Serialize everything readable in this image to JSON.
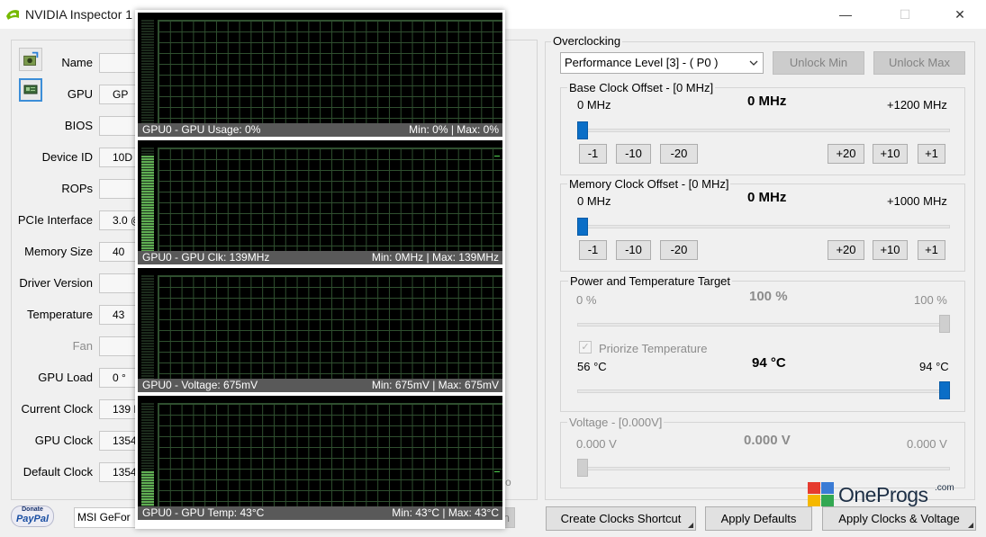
{
  "window": {
    "title": "NVIDIA Inspector 1",
    "minimize_icon": "—",
    "maximize_icon": "☐",
    "close_icon": "✕"
  },
  "left_panel": {
    "fields": [
      {
        "label": "Name",
        "value": "",
        "disabled": false
      },
      {
        "label": "GPU",
        "value": "GP",
        "disabled": false
      },
      {
        "label": "BIOS",
        "value": "",
        "disabled": false
      },
      {
        "label": "Device ID",
        "value": "10D",
        "disabled": false
      },
      {
        "label": "ROPs",
        "value": "",
        "disabled": false
      },
      {
        "label": "PCIe Interface",
        "value": "3.0 @",
        "disabled": false
      },
      {
        "label": "Memory Size",
        "value": "40",
        "disabled": false
      },
      {
        "label": "Driver Version",
        "value": "",
        "disabled": false
      },
      {
        "label": "Temperature",
        "value": "43",
        "disabled": false
      },
      {
        "label": "Fan",
        "value": "",
        "disabled": true
      },
      {
        "label": "GPU Load",
        "value": "0 °",
        "disabled": false
      },
      {
        "label": "Current Clock",
        "value": "139 M",
        "disabled": false
      },
      {
        "label": "GPU Clock",
        "value": "1354",
        "disabled": false
      },
      {
        "label": "Default Clock",
        "value": "1354",
        "disabled": false
      }
    ],
    "gpu_select": "MSI GeFor",
    "donate_top": "Donate",
    "donate_brand": "PayPal",
    "hidden_chars": {
      "right_mark": "o",
      "btn_fragment": "n"
    }
  },
  "monitor": {
    "graphs": [
      {
        "left": "GPU0 - GPU Usage: 0%",
        "right": "Min: 0% | Max: 0%",
        "fill": 0
      },
      {
        "left": "GPU0 - GPU Clk: 139MHz",
        "right": "Min: 0MHz | Max: 139MHz",
        "fill": 0.92
      },
      {
        "left": "GPU0 - Voltage: 675mV",
        "right": "Min: 675mV | Max: 675mV",
        "fill": 0
      },
      {
        "left": "GPU0 - GPU Temp: 43°C",
        "right": "Min: 43°C | Max: 43°C",
        "fill": 0.36
      }
    ]
  },
  "overclocking": {
    "title": "Overclocking",
    "perf_level": "Performance Level [3] - ( P0 )",
    "unlock_min": "Unlock Min",
    "unlock_max": "Unlock Max",
    "base_clock": {
      "title": "Base Clock Offset - [0 MHz]",
      "min": "0 MHz",
      "value": "0 MHz",
      "max": "+1200 MHz",
      "position": 0
    },
    "mem_clock": {
      "title": "Memory Clock Offset - [0 MHz]",
      "min": "0 MHz",
      "value": "0 MHz",
      "max": "+1000 MHz",
      "position": 0
    },
    "step_buttons": [
      "-1",
      "-10",
      "-20",
      "+20",
      "+10",
      "+1"
    ],
    "power": {
      "title": "Power and Temperature Target",
      "min": "0 %",
      "value": "100 %",
      "max": "100 %",
      "position": 1,
      "prioritize_label": "Priorize Temperature",
      "checked": true,
      "temp_min": "56 °C",
      "temp_value": "94 °C",
      "temp_max": "94 °C",
      "temp_position": 1
    },
    "voltage": {
      "title": "Voltage - [0.000V]",
      "min": "0.000 V",
      "value": "0.000 V",
      "max": "0.000 V",
      "position": 0
    }
  },
  "bottom_buttons": {
    "create_shortcut": "Create Clocks Shortcut",
    "apply_defaults": "Apply Defaults",
    "apply_clocks": "Apply Clocks & Voltage"
  },
  "watermark": {
    "brand": "OneProgs",
    "suffix": ".com"
  },
  "colors": {
    "accent": "#0a6ec7",
    "graph_green": "#5fae52",
    "info_bar": "#595959"
  }
}
